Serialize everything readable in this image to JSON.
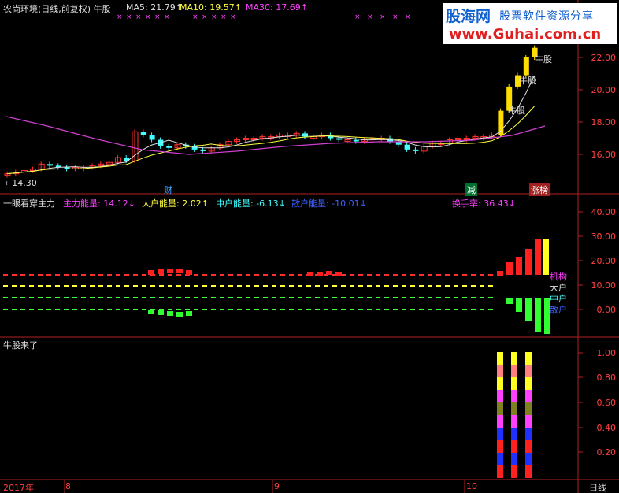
{
  "header": {
    "stock": "农尚环境(日线,前复权) 牛股",
    "ma5": "MA5: 21.79↑",
    "ma10": "MA10: 19.57↑",
    "ma30": "MA30: 17.69↑"
  },
  "logo": {
    "brand": "股海网",
    "slogan": "股票软件资源分享",
    "url": "www.Guhai.com.cn"
  },
  "main_axis": [
    "22.00",
    "20.00",
    "18.00",
    "16.00"
  ],
  "low_label": "←14.30",
  "price_annotations": [
    "牛股",
    "牛股",
    "牛股"
  ],
  "markers": {
    "cai": "财",
    "jian": "减",
    "zhangbang": "涨榜"
  },
  "indicator": {
    "title": "一眼看穿主力",
    "main_force": "主力能量: 14.12↓",
    "big_holder": "大户能量: 2.02↑",
    "mid_holder": "中户能量: -6.13↓",
    "retail": "散户能量: -10.01↓",
    "turnover": "换手率: 36.43↓",
    "axis": [
      "40.00",
      "30.00",
      "20.00",
      "10.00",
      "0.00"
    ],
    "legend": [
      "机构",
      "大户",
      "中户",
      "散户"
    ]
  },
  "bottom": {
    "title": "牛股来了",
    "axis": [
      "1.00",
      "0.80",
      "0.60",
      "0.40",
      "0.20"
    ]
  },
  "timeline": {
    "labels": [
      "2017年",
      "8",
      "9",
      "10"
    ],
    "period": "日线"
  },
  "chart_data": {
    "type": "candlestick",
    "title": "农尚环境(日线,前复权) 牛股",
    "y_axis_ticks": [
      16,
      18,
      20,
      22
    ],
    "low": 14.3,
    "ma_series": [
      {
        "name": "MA5",
        "value": 21.79
      },
      {
        "name": "MA10",
        "value": 19.57
      },
      {
        "name": "MA30",
        "value": 17.69
      }
    ],
    "indicator_values": {
      "主力能量": 14.12,
      "大户能量": 2.02,
      "中户能量": -6.13,
      "散户能量": -10.01,
      "换手率": 36.43
    }
  }
}
